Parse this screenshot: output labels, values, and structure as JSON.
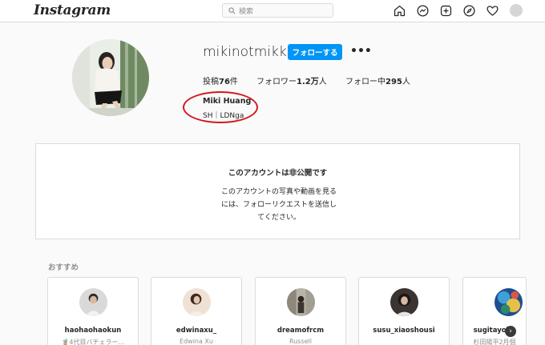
{
  "header": {
    "logo": "Instagram",
    "search": {
      "placeholder": "検索",
      "icon": "search-icon"
    },
    "nav_icons": [
      "home-icon",
      "messenger-icon",
      "new-post-icon",
      "explore-icon",
      "heart-icon",
      "avatar"
    ]
  },
  "profile": {
    "username": "mikinotmikki",
    "follow_label": "フォローする",
    "more_label": "•••",
    "stats": {
      "posts_label": "投稿",
      "posts_value": "76",
      "posts_unit": "件",
      "followers_label": "フォロワー",
      "followers_value": "1.2万",
      "followers_unit": "人",
      "following_label": "フォロー中",
      "following_value": "295",
      "following_unit": "人"
    },
    "full_name": "Miki Huang",
    "bio": "SH｜LDNga",
    "annotation_color": "#d3171e"
  },
  "private_notice": {
    "title": "このアカウントは非公開です",
    "line1": "このアカウントの写真や動画を見る",
    "line2": "には、フォローリクエストを送信し",
    "line3": "てください。"
  },
  "recommendations": {
    "title": "おすすめ",
    "items": [
      {
        "username": "haohaohaokun",
        "subtitle": "🧋4代目バチェラー…"
      },
      {
        "username": "edwinaxu_",
        "subtitle": "Edwina Xu"
      },
      {
        "username": "dreamofrcm",
        "subtitle": "Russell"
      },
      {
        "username": "susu_xiaoshousi",
        "subtitle": ""
      },
      {
        "username": "sugitayohe",
        "subtitle": "杉田陽平2月個"
      }
    ],
    "next_label": "›"
  },
  "colors": {
    "accent": "#0095f6",
    "border": "#dbdbdb",
    "background": "#fafafa"
  }
}
